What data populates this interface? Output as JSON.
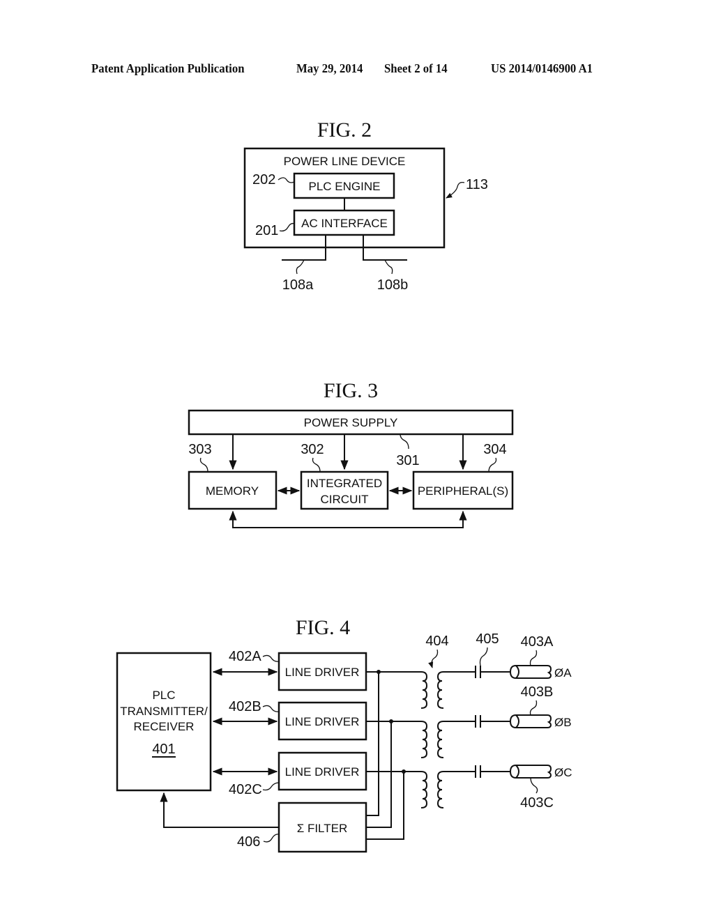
{
  "header": {
    "publication": "Patent Application Publication",
    "date": "May 29, 2014",
    "sheet": "Sheet 2 of 14",
    "number": "US 2014/0146900 A1"
  },
  "fig2": {
    "title": "FIG. 2",
    "device_label": "POWER LINE DEVICE",
    "plc_engine": "PLC ENGINE",
    "ac_interface": "AC INTERFACE",
    "ref_device": "113",
    "ref_plc_engine": "202",
    "ref_ac_interface": "201",
    "ref_line_a": "108a",
    "ref_line_b": "108b"
  },
  "fig3": {
    "title": "FIG. 3",
    "power_supply": "POWER SUPPLY",
    "memory": "MEMORY",
    "ic_line1": "INTEGRATED",
    "ic_line2": "CIRCUIT",
    "peripherals": "PERIPHERAL(S)",
    "ref_power_supply": "301",
    "ref_ic": "302",
    "ref_memory": "303",
    "ref_peripherals": "304"
  },
  "fig4": {
    "title": "FIG. 4",
    "plc_line1": "PLC",
    "plc_line2": "TRANSMITTER/",
    "plc_line3": "RECEIVER",
    "plc_ref": "401",
    "line_drivers": [
      {
        "label": "LINE DRIVER",
        "ref": "402A"
      },
      {
        "label": "LINE DRIVER",
        "ref": "402B"
      },
      {
        "label": "LINE DRIVER",
        "ref": "402C"
      }
    ],
    "filter": "Σ FILTER",
    "ref_filter": "406",
    "ref_transformer": "404",
    "ref_capacitor": "405",
    "phases": [
      {
        "ref": "403A",
        "label": "ØA"
      },
      {
        "ref": "403B",
        "label": "ØB"
      },
      {
        "ref": "403C",
        "label": "ØC"
      }
    ]
  }
}
